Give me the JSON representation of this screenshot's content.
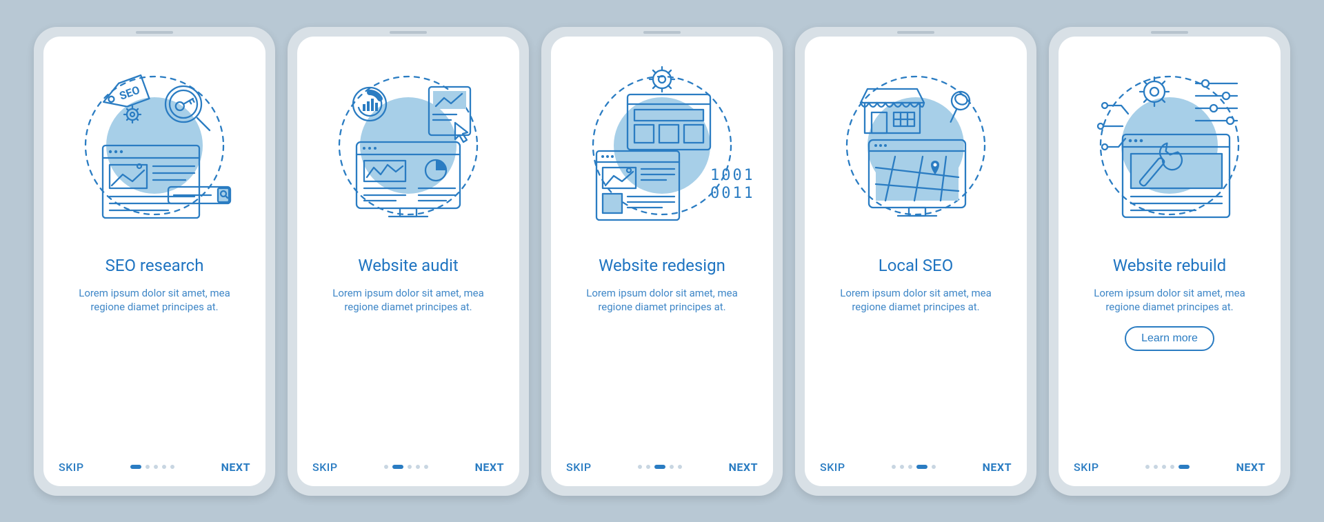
{
  "colors": {
    "primary": "#2a7cc2",
    "accent": "#a7cfe8",
    "background": "#b8c8d4"
  },
  "screens": [
    {
      "title": "SEO research",
      "body": "Lorem ipsum dolor sit amet, mea regione diamet principes at.",
      "skip": "SKIP",
      "next": "NEXT",
      "dots_total": 5,
      "dot_active": 0,
      "learn_more": null,
      "tag_text": "SEO"
    },
    {
      "title": "Website audit",
      "body": "Lorem ipsum dolor sit amet, mea regione diamet principes at.",
      "skip": "SKIP",
      "next": "NEXT",
      "dots_total": 5,
      "dot_active": 1,
      "learn_more": null
    },
    {
      "title": "Website redesign",
      "body": "Lorem ipsum dolor sit amet, mea regione diamet principes at.",
      "skip": "SKIP",
      "next": "NEXT",
      "dots_total": 5,
      "dot_active": 2,
      "learn_more": null,
      "binary": "1001\n0011"
    },
    {
      "title": "Local SEO",
      "body": "Lorem ipsum dolor sit amet, mea regione diamet principes at.",
      "skip": "SKIP",
      "next": "NEXT",
      "dots_total": 5,
      "dot_active": 3,
      "learn_more": null
    },
    {
      "title": "Website rebuild",
      "body": "Lorem ipsum dolor sit amet, mea regione diamet principes at.",
      "skip": "SKIP",
      "next": "NEXT",
      "dots_total": 5,
      "dot_active": 4,
      "learn_more": "Learn more"
    }
  ]
}
